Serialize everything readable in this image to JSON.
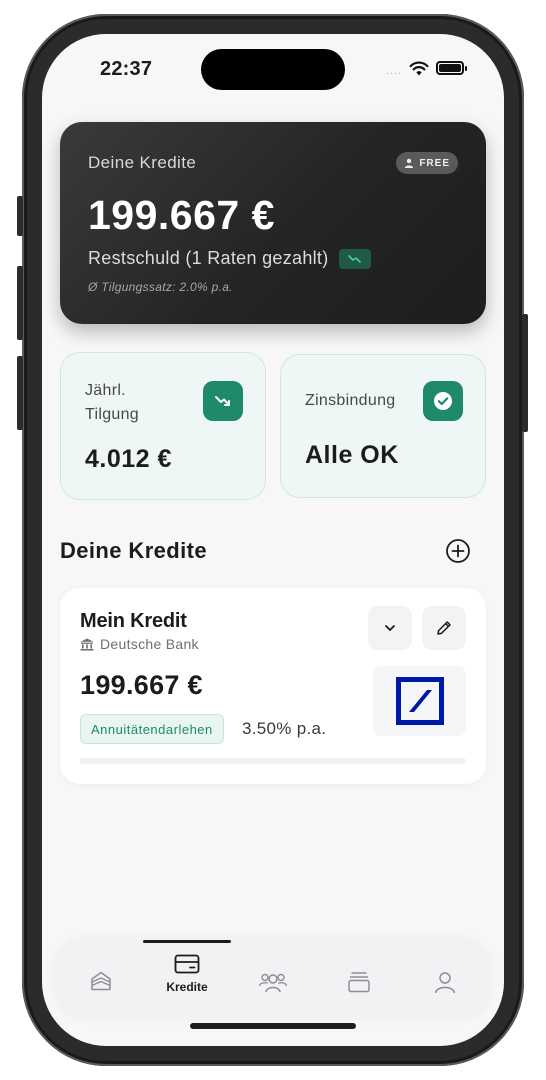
{
  "status_bar": {
    "time": "22:37",
    "signal": "....",
    "wifi_icon": "wifi-icon",
    "battery_icon": "battery-icon"
  },
  "summary": {
    "title": "Deine Kredite",
    "badge": "FREE",
    "amount": "199.667 €",
    "subtitle": "Restschuld (1 Raten gezahlt)",
    "note": "Ø Tilgungssatz: 2.0% p.a."
  },
  "stats": [
    {
      "label_line1": "Jährl.",
      "label_line2": "Tilgung",
      "value": "4.012 €",
      "icon": "trend-down-icon"
    },
    {
      "label_line1": "Zinsbindung",
      "label_line2": "",
      "value": "Alle OK",
      "icon": "check-circle-icon"
    }
  ],
  "section": {
    "title": "Deine Kredite"
  },
  "credits": [
    {
      "name": "Mein Kredit",
      "bank": "Deutsche Bank",
      "amount": "199.667 €",
      "type": "Annuitätendarlehen",
      "rate": "3.50% p.a."
    }
  ],
  "tabbar": {
    "active": "Kredite",
    "tabs": [
      {
        "icon": "home-icon",
        "label": ""
      },
      {
        "icon": "credit-card-icon",
        "label": "Kredite"
      },
      {
        "icon": "users-icon",
        "label": ""
      },
      {
        "icon": "stack-icon",
        "label": ""
      },
      {
        "icon": "profile-icon",
        "label": ""
      }
    ]
  },
  "colors": {
    "accent": "#1f8a6b",
    "card_dark": "#2a2a2c",
    "tile_bg": "#eef7f5",
    "bank_blue": "#0018a8"
  }
}
